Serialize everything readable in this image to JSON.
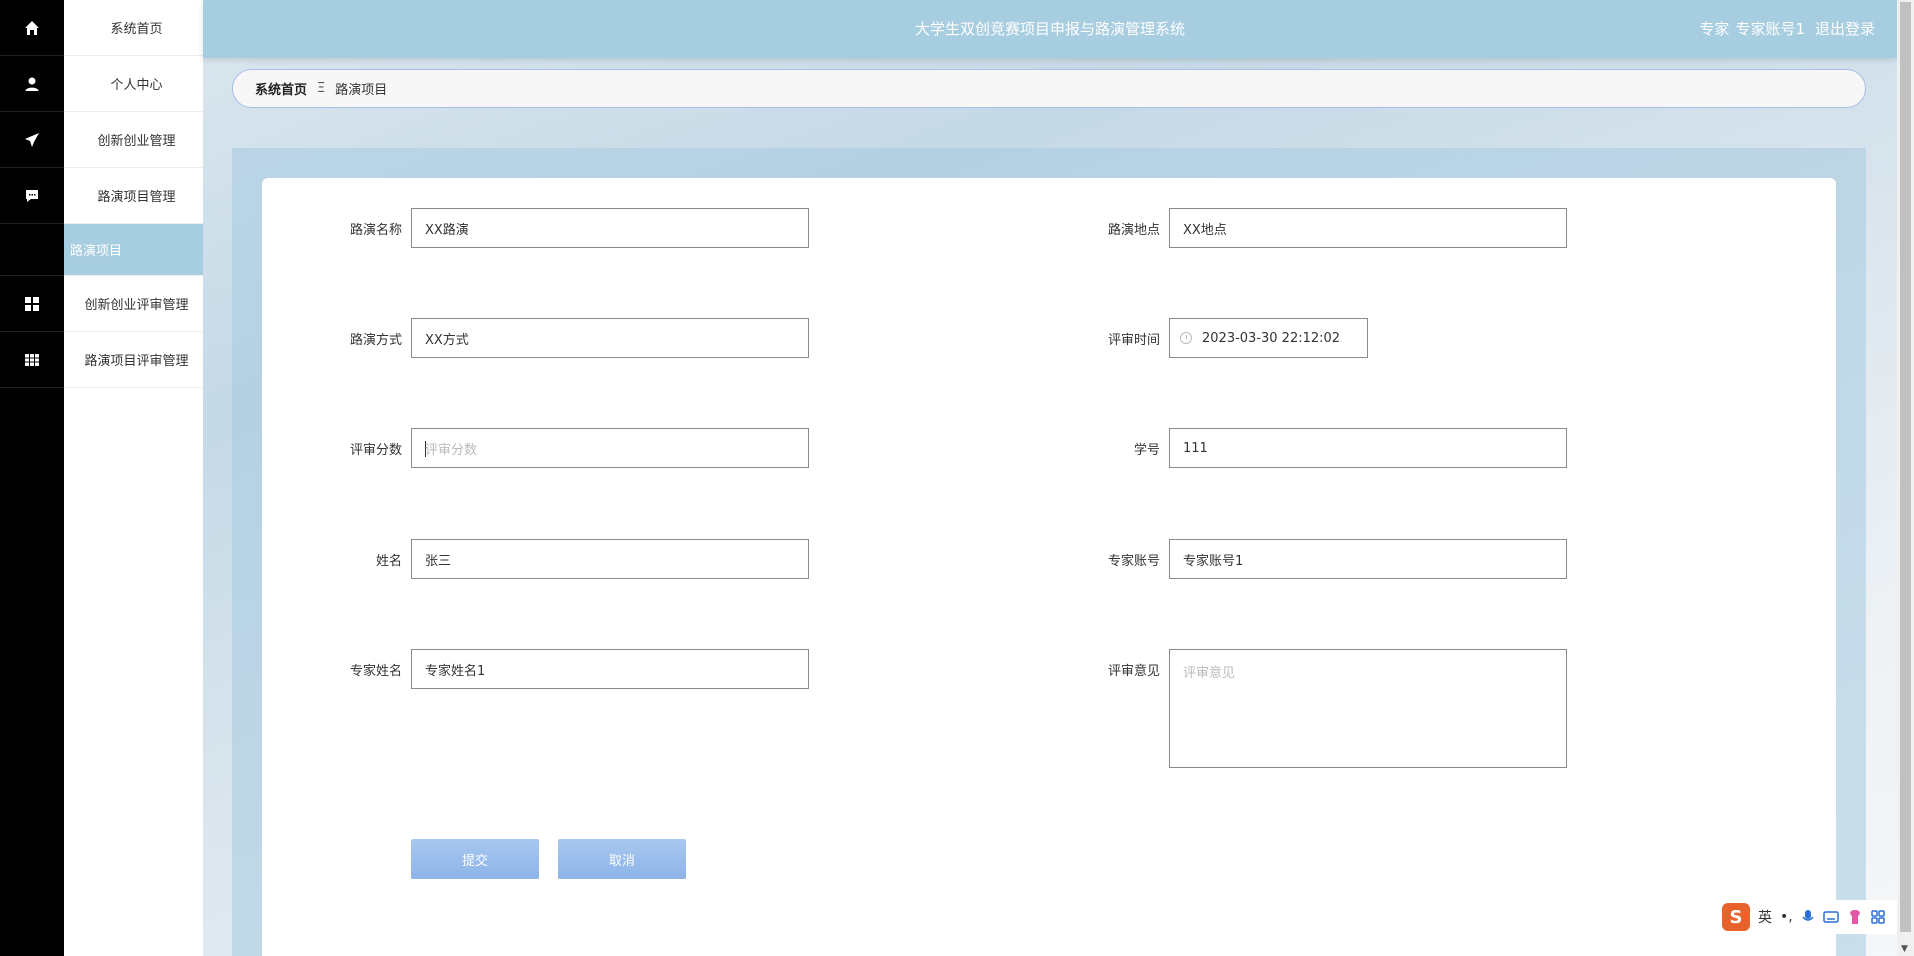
{
  "app": {
    "title": "大学生双创竞赛项目申报与路演管理系统",
    "user_role": "专家",
    "user_name": "专家账号1",
    "logout": "退出登录"
  },
  "sidebar": {
    "items": [
      {
        "label": "系统首页",
        "icon": "home-icon"
      },
      {
        "label": "个人中心",
        "icon": "user-icon"
      },
      {
        "label": "创新创业管理",
        "icon": "paper-plane-icon"
      },
      {
        "label": "路演项目管理",
        "icon": "chat-bubble-icon"
      },
      {
        "label": "路演项目",
        "active": true
      },
      {
        "label": "创新创业评审管理",
        "icon": "grid-icon"
      },
      {
        "label": "路演项目评审管理",
        "icon": "table-grid-icon"
      }
    ]
  },
  "breadcrumb": {
    "home": "系统首页",
    "separator": "Ξ",
    "current": "路演项目"
  },
  "form": {
    "roadshow_name": {
      "label": "路演名称",
      "value": "XX路演"
    },
    "roadshow_location": {
      "label": "路演地点",
      "value": "XX地点"
    },
    "roadshow_method": {
      "label": "路演方式",
      "value": "XX方式"
    },
    "review_time": {
      "label": "评审时间",
      "value": "2023-03-30 22:12:02"
    },
    "review_score": {
      "label": "评审分数",
      "value": "",
      "placeholder": "评审分数"
    },
    "student_id": {
      "label": "学号",
      "value": "111"
    },
    "name": {
      "label": "姓名",
      "value": "张三"
    },
    "expert_account": {
      "label": "专家账号",
      "value": "专家账号1"
    },
    "expert_name": {
      "label": "专家姓名",
      "value": "专家姓名1"
    },
    "review_opinion": {
      "label": "评审意见",
      "value": "",
      "placeholder": "评审意见"
    },
    "submit": "提交",
    "cancel": "取消"
  },
  "ime": {
    "logo": "S",
    "mode": "英",
    "punct": "•,"
  },
  "colors": {
    "accent": "#a7cde0",
    "button": "#8db3e8",
    "sidebar_rail": "#000000"
  }
}
